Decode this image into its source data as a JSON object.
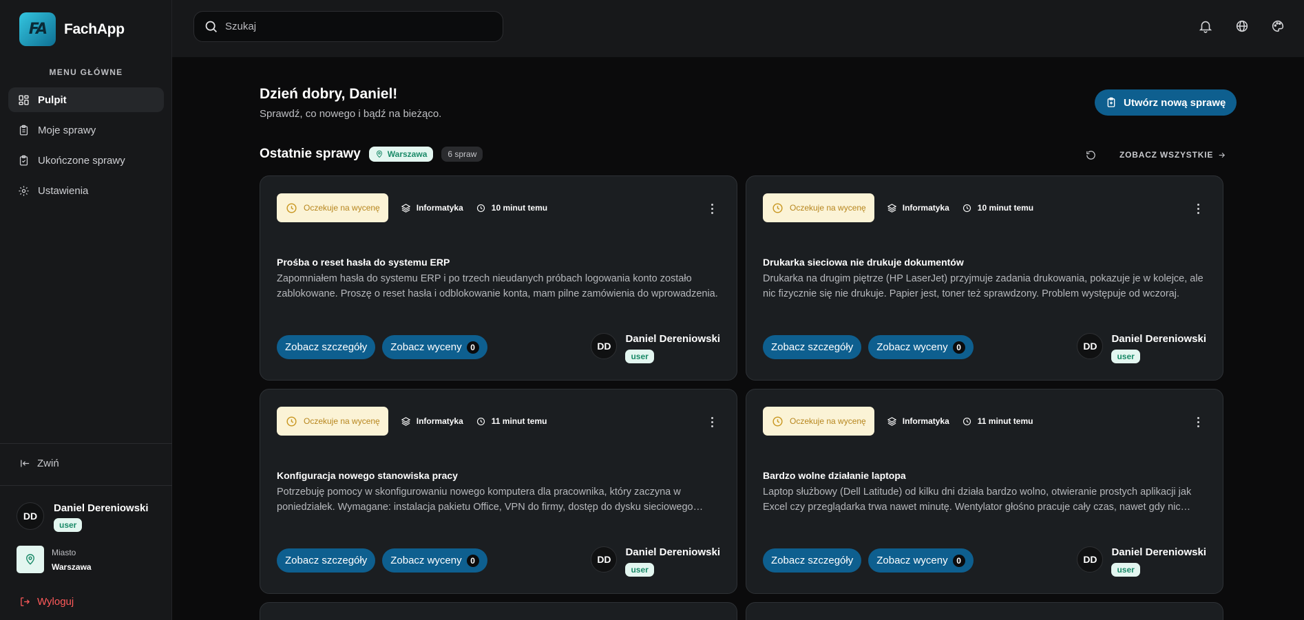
{
  "app": {
    "name": "FachApp",
    "logo_text": "FA"
  },
  "sidebar": {
    "menu_title": "MENU GŁÓWNE",
    "items": [
      {
        "label": "Pulpit",
        "icon": "dashboard-icon",
        "active": true
      },
      {
        "label": "Moje sprawy",
        "icon": "clipboard-icon",
        "active": false
      },
      {
        "label": "Ukończone sprawy",
        "icon": "clipboard-check-icon",
        "active": false
      },
      {
        "label": "Ustawienia",
        "icon": "gear-icon",
        "active": false
      }
    ],
    "collapse_label": "Zwiń",
    "user": {
      "initials": "DD",
      "name": "Daniel Dereniowski",
      "role": "user"
    },
    "city": {
      "label": "Miasto",
      "value": "Warszawa"
    },
    "logout_label": "Wyloguj"
  },
  "topbar": {
    "search_placeholder": "Szukaj",
    "icons": [
      "bell-icon",
      "globe-icon",
      "palette-icon"
    ]
  },
  "main": {
    "greeting": "Dzień dobry, Daniel!",
    "subtitle": "Sprawdź, co nowego i bądź na bieżąco.",
    "create_button": "Utwórz nową sprawę",
    "section_title": "Ostatnie sprawy",
    "location_badge": "Warszawa",
    "count_badge": "6 spraw",
    "see_all": "ZOBACZ WSZYSTKIE"
  },
  "cards": [
    {
      "status": "Oczekuje na wycenę",
      "category": "Informatyka",
      "time": "10 minut temu",
      "title": "Prośba o reset hasła do systemu ERP",
      "description": "Zapomniałem hasła do systemu ERP i po trzech nieudanych próbach logowania konto zostało zablokowane. Proszę o reset hasła i odblokowanie konta, mam pilne zamówienia do wprowadzenia.",
      "details_label": "Zobacz szczegóły",
      "quotes_label": "Zobacz wyceny",
      "quotes_count": "0",
      "user_initials": "DD",
      "user_name": "Daniel Dereniowski",
      "user_role": "user"
    },
    {
      "status": "Oczekuje na wycenę",
      "category": "Informatyka",
      "time": "10 minut temu",
      "title": "Drukarka sieciowa nie drukuje dokumentów",
      "description": "Drukarka na drugim piętrze (HP LaserJet) przyjmuje zadania drukowania, pokazuje je w kolejce, ale nic fizycznie się nie drukuje. Papier jest, toner też sprawdzony. Problem występuje od wczoraj.",
      "details_label": "Zobacz szczegóły",
      "quotes_label": "Zobacz wyceny",
      "quotes_count": "0",
      "user_initials": "DD",
      "user_name": "Daniel Dereniowski",
      "user_role": "user"
    },
    {
      "status": "Oczekuje na wycenę",
      "category": "Informatyka",
      "time": "11 minut temu",
      "title": "Konfiguracja nowego stanowiska pracy",
      "description": "Potrzebuję pomocy w skonfigurowaniu nowego komputera dla pracownika, który zaczyna w poniedziałek. Wymagane: instalacja pakietu Office, VPN do firmy, dostęp do dysku sieciowego oraz…",
      "details_label": "Zobacz szczegóły",
      "quotes_label": "Zobacz wyceny",
      "quotes_count": "0",
      "user_initials": "DD",
      "user_name": "Daniel Dereniowski",
      "user_role": "user"
    },
    {
      "status": "Oczekuje na wycenę",
      "category": "Informatyka",
      "time": "11 minut temu",
      "title": "Bardzo wolne działanie laptopa",
      "description": "Laptop służbowy (Dell Latitude) od kilku dni działa bardzo wolno, otwieranie prostych aplikacji jak Excel czy przeglądarka trwa nawet minutę. Wentylator głośno pracuje cały czas, nawet gdy nic nie…",
      "details_label": "Zobacz szczegóły",
      "quotes_label": "Zobacz wyceny",
      "quotes_count": "0",
      "user_initials": "DD",
      "user_name": "Daniel Dereniowski",
      "user_role": "user"
    }
  ]
}
